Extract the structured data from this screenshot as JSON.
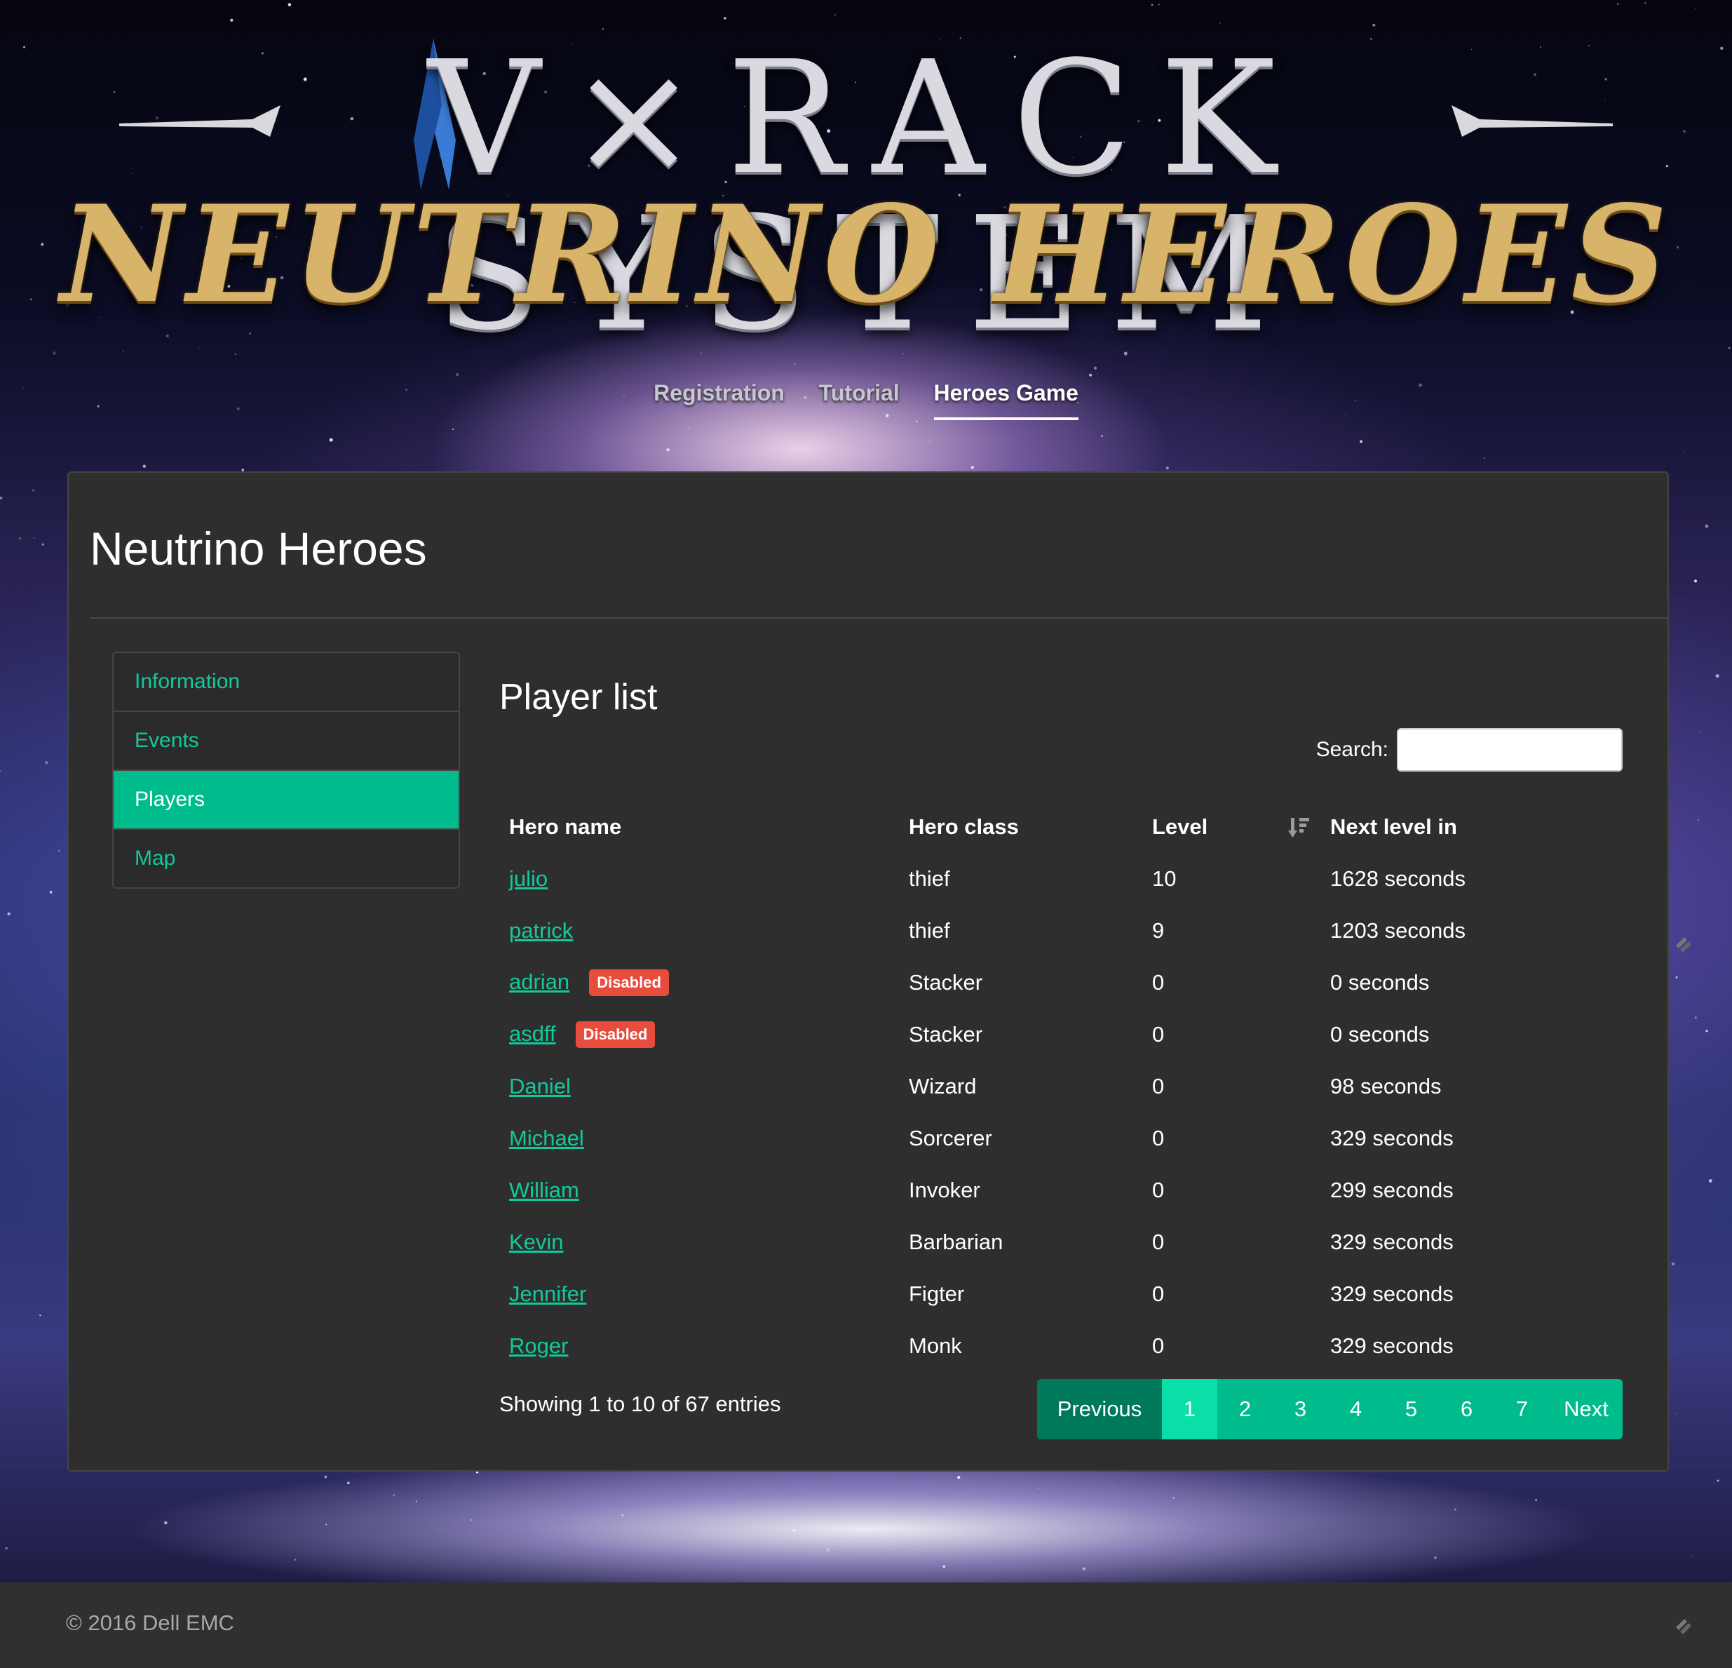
{
  "logo": {
    "line1": "V×RACK SYSTEM",
    "line2": "NEUTRINO HEROES"
  },
  "topnav": {
    "items": [
      {
        "label": "Registration"
      },
      {
        "label": "Tutorial"
      },
      {
        "label": "Heroes Game"
      }
    ],
    "active": "Heroes Game"
  },
  "page": {
    "title": "Neutrino Heroes"
  },
  "sidebar": {
    "items": [
      {
        "label": "Information"
      },
      {
        "label": "Events"
      },
      {
        "label": "Players"
      },
      {
        "label": "Map"
      }
    ],
    "active": "Players"
  },
  "players": {
    "heading": "Player list",
    "search": {
      "label": "Search:",
      "value": "",
      "placeholder": ""
    },
    "columns": [
      "Hero name",
      "Hero class",
      "Level",
      "Next level in"
    ],
    "sorted_column": "Level",
    "sort_icon": "sort-descending-icon",
    "rows": [
      {
        "name": "julio",
        "badge": "",
        "class": "thief",
        "level": "10",
        "next": "1628 seconds"
      },
      {
        "name": "patrick",
        "badge": "",
        "class": "thief",
        "level": "9",
        "next": "1203 seconds"
      },
      {
        "name": "adrian",
        "badge": "Disabled",
        "class": "Stacker",
        "level": "0",
        "next": "0 seconds"
      },
      {
        "name": "asdff",
        "badge": "Disabled",
        "class": "Stacker",
        "level": "0",
        "next": "0 seconds"
      },
      {
        "name": "Daniel",
        "badge": "",
        "class": "Wizard",
        "level": "0",
        "next": "98 seconds"
      },
      {
        "name": "Michael",
        "badge": "",
        "class": "Sorcerer",
        "level": "0",
        "next": "329 seconds"
      },
      {
        "name": "William",
        "badge": "",
        "class": "Invoker",
        "level": "0",
        "next": "299 seconds"
      },
      {
        "name": "Kevin",
        "badge": "",
        "class": "Barbarian",
        "level": "0",
        "next": "329 seconds"
      },
      {
        "name": "Jennifer",
        "badge": "",
        "class": "Figter",
        "level": "0",
        "next": "329 seconds"
      },
      {
        "name": "Roger",
        "badge": "",
        "class": "Monk",
        "level": "0",
        "next": "329 seconds"
      }
    ],
    "info": "Showing 1 to 10 of 67 entries",
    "pagination": {
      "previous": "Previous",
      "pages": [
        "1",
        "2",
        "3",
        "4",
        "5",
        "6",
        "7"
      ],
      "current": "1",
      "next": "Next"
    }
  },
  "footer": {
    "copyright": "© 2016 Dell EMC"
  },
  "colors": {
    "accent": "#00bc8c",
    "link": "#12c99a",
    "danger": "#e74c3c",
    "panel": "#2e2e2f",
    "footer": "#303030"
  }
}
